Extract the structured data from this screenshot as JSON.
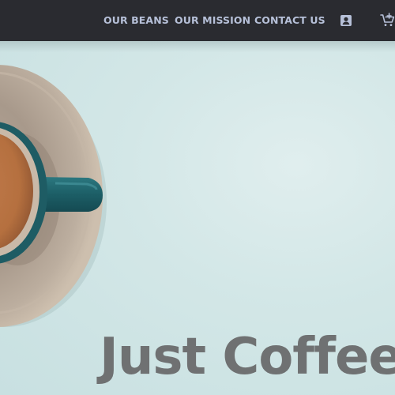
{
  "nav": {
    "links": [
      {
        "label": "OUR BEANS"
      },
      {
        "label": "OUR MISSION"
      },
      {
        "label": "CONTACT US"
      }
    ],
    "icons": {
      "account": "account-icon",
      "cart": "cart-icon"
    }
  },
  "hero": {
    "title": "Just Coffee",
    "image": "coffee-cup-on-saucer"
  },
  "colors": {
    "navbar": "#2a2b30",
    "nav_text": "#b6c0d8",
    "background": "#cfe4e4",
    "cup": "#1f5f66",
    "title": "#6f7172"
  }
}
